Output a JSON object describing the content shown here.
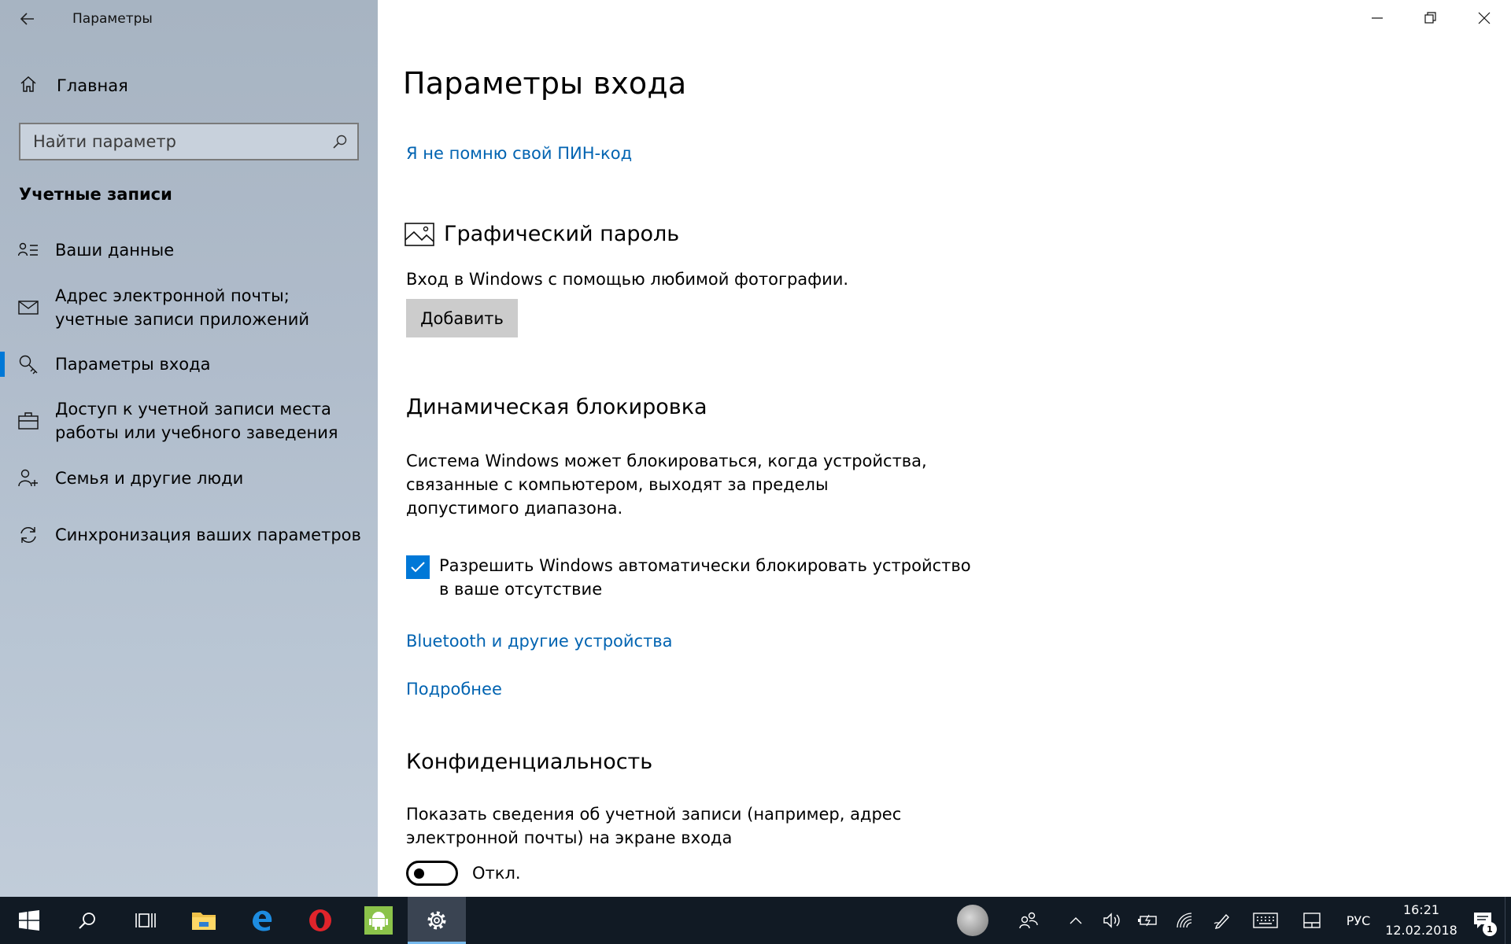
{
  "window": {
    "title": "Параметры"
  },
  "sidebar": {
    "home_label": "Главная",
    "search_placeholder": "Найти параметр",
    "section_title": "Учетные записи",
    "items": [
      {
        "label": "Ваши данные",
        "icon": "person-list-icon"
      },
      {
        "label": "Адрес электронной почты; учетные записи приложений",
        "icon": "mail-icon"
      },
      {
        "label": "Параметры входа",
        "icon": "key-icon",
        "active": true
      },
      {
        "label": "Доступ к учетной записи места работы или учебного заведения",
        "icon": "briefcase-icon"
      },
      {
        "label": "Семья и другие люди",
        "icon": "add-person-icon"
      },
      {
        "label": "Синхронизация ваших параметров",
        "icon": "sync-icon"
      }
    ]
  },
  "main": {
    "page_title": "Параметры входа",
    "pin_link": "Я не помню свой ПИН-код",
    "picture_password": {
      "title": "Графический пароль",
      "description": "Вход в Windows с помощью любимой фотографии.",
      "button": "Добавить"
    },
    "dynamic_lock": {
      "title": "Динамическая блокировка",
      "description": "Система Windows может блокироваться, когда устройства, связанные с компьютером, выходят за пределы допустимого диапазона.",
      "checkbox_label": "Разрешить Windows автоматически блокировать устройство в ваше отсутствие",
      "checked": true,
      "link_bluetooth": "Bluetooth и другие устройства",
      "link_more": "Подробнее"
    },
    "privacy": {
      "title": "Конфиденциальность",
      "description": "Показать сведения об учетной записи (например, адрес электронной почты) на экране входа",
      "toggle_state": "Откл."
    }
  },
  "taskbar": {
    "language": "РУС",
    "time": "16:21",
    "date": "12.02.2018",
    "notification_count": "1",
    "accent": "#0078d7"
  }
}
